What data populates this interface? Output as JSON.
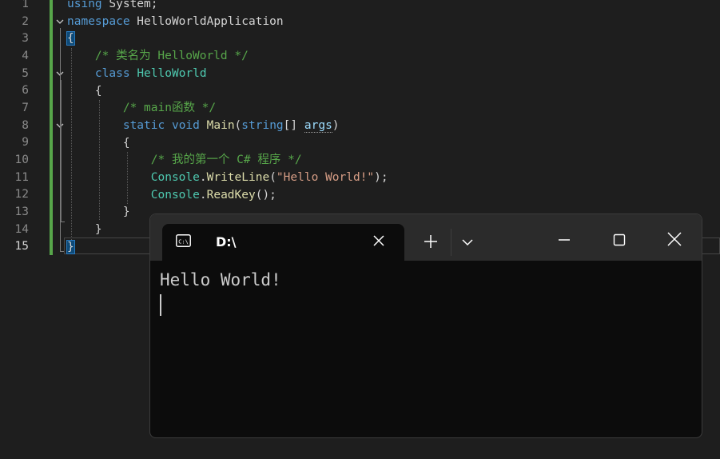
{
  "editor": {
    "line_numbers": [
      "1",
      "2",
      "3",
      "4",
      "5",
      "6",
      "7",
      "8",
      "9",
      "10",
      "11",
      "12",
      "13",
      "14",
      "15"
    ],
    "current_line": "15",
    "lines": [
      [
        {
          "t": "using",
          "c": "kw"
        },
        {
          "t": " System;",
          "c": "pl"
        }
      ],
      [
        {
          "t": "namespace",
          "c": "kw"
        },
        {
          "t": " HelloWorldApplication",
          "c": "pl"
        }
      ],
      [
        {
          "t": "{",
          "c": "pl",
          "hl": true
        }
      ],
      [
        {
          "t": "    ",
          "c": "pl"
        },
        {
          "t": "/* 类名为 HelloWorld */",
          "c": "cm"
        }
      ],
      [
        {
          "t": "    ",
          "c": "pl"
        },
        {
          "t": "class",
          "c": "kw"
        },
        {
          "t": " ",
          "c": "pl"
        },
        {
          "t": "HelloWorld",
          "c": "ty"
        }
      ],
      [
        {
          "t": "    {",
          "c": "pl"
        }
      ],
      [
        {
          "t": "        ",
          "c": "pl"
        },
        {
          "t": "/* main函数 */",
          "c": "cm"
        }
      ],
      [
        {
          "t": "        ",
          "c": "pl"
        },
        {
          "t": "static",
          "c": "kw"
        },
        {
          "t": " ",
          "c": "pl"
        },
        {
          "t": "void",
          "c": "kw"
        },
        {
          "t": " ",
          "c": "pl"
        },
        {
          "t": "Main",
          "c": "fn"
        },
        {
          "t": "(",
          "c": "pl"
        },
        {
          "t": "string",
          "c": "kw"
        },
        {
          "t": "[] ",
          "c": "pl"
        },
        {
          "t": "args",
          "c": "pr",
          "sq": true
        },
        {
          "t": ")",
          "c": "pl"
        }
      ],
      [
        {
          "t": "        {",
          "c": "pl"
        }
      ],
      [
        {
          "t": "            ",
          "c": "pl"
        },
        {
          "t": "/* 我的第一个 C# 程序 */",
          "c": "cm"
        }
      ],
      [
        {
          "t": "            ",
          "c": "pl"
        },
        {
          "t": "Console",
          "c": "ty"
        },
        {
          "t": ".",
          "c": "pl"
        },
        {
          "t": "WriteLine",
          "c": "fn"
        },
        {
          "t": "(",
          "c": "pl"
        },
        {
          "t": "\"Hello World!\"",
          "c": "st"
        },
        {
          "t": ");",
          "c": "pl"
        }
      ],
      [
        {
          "t": "            ",
          "c": "pl"
        },
        {
          "t": "Console",
          "c": "ty"
        },
        {
          "t": ".",
          "c": "pl"
        },
        {
          "t": "ReadKey",
          "c": "fn"
        },
        {
          "t": "();",
          "c": "pl"
        }
      ],
      [
        {
          "t": "        }",
          "c": "pl"
        }
      ],
      [
        {
          "t": "    }",
          "c": "pl"
        }
      ],
      [
        {
          "t": "}",
          "c": "pl",
          "hl": true
        }
      ]
    ]
  },
  "terminal": {
    "tab_title": "D:\\",
    "output": "Hello World!",
    "icons": {
      "tab_icon": "terminal-prompt-icon",
      "tab_close": "close-icon",
      "new_tab": "plus-icon",
      "dropdown": "chevron-down-icon",
      "minimize": "minimize-icon",
      "maximize": "maximize-icon",
      "close": "close-icon"
    }
  },
  "colors": {
    "editor_bg": "#1e1e1e",
    "keyword": "#569cd6",
    "type": "#4ec9b0",
    "method": "#dcdcaa",
    "comment": "#57a64a",
    "string": "#d69d85",
    "terminal_bg": "#0c0c0c",
    "terminal_titlebar": "#2b2b2b"
  }
}
